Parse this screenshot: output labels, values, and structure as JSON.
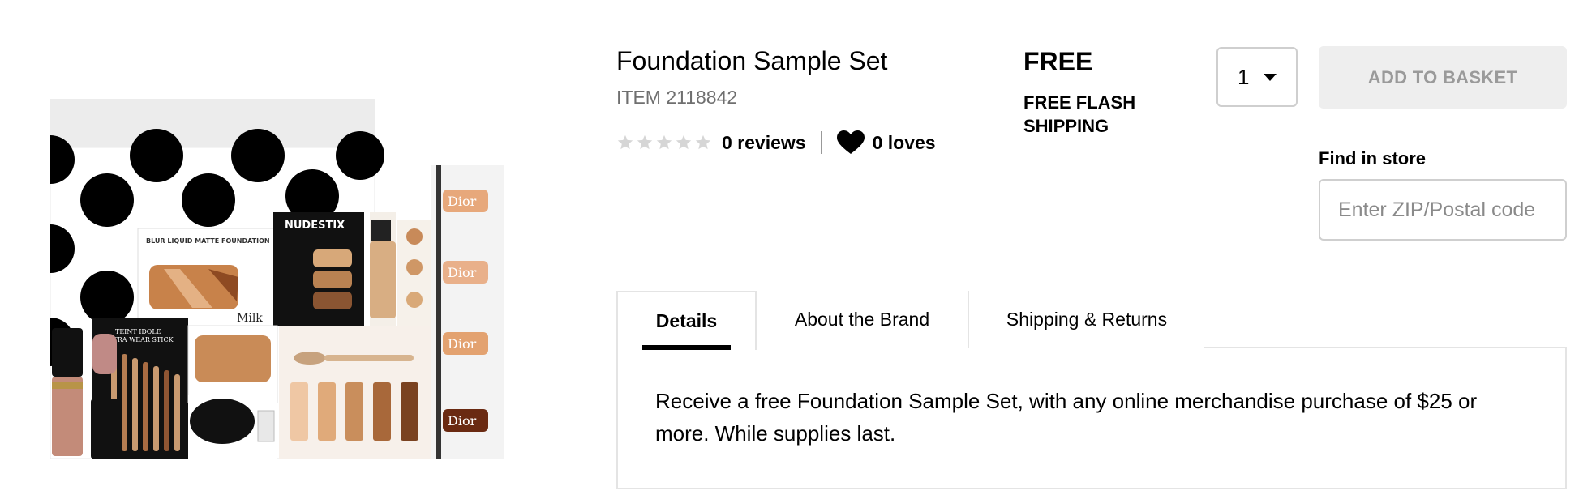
{
  "product": {
    "title": "Foundation Sample Set",
    "item_number": "ITEM 2118842",
    "rating_stars": 0,
    "reviews_label": "0 reviews",
    "loves_label": "0 loves",
    "image_texts": {
      "card1": "BLUR LIQUID MATTE FOUNDATION",
      "milk": "Milk",
      "nudestix": "NUDESTIX",
      "teint": "TEINT IDOLE",
      "teint2": "ULTRA WEAR STICK",
      "dior": "Dior"
    }
  },
  "price": {
    "amount": "FREE",
    "shipping_note": "FREE FLASH SHIPPING"
  },
  "purchase": {
    "quantity": "1",
    "add_to_basket_label": "ADD TO BASKET",
    "find_in_store_label": "Find in store",
    "zip_placeholder": "Enter ZIP/Postal code"
  },
  "tabs": [
    {
      "label": "Details",
      "active": true
    },
    {
      "label": "About the Brand",
      "active": false
    },
    {
      "label": "Shipping & Returns",
      "active": false
    }
  ],
  "details_text": "Receive a free Foundation Sample Set, with any online merchandise purchase of $25 or more. While supplies last.",
  "icons": {
    "star": "star-outline-icon",
    "heart": "heart-icon",
    "quantity_caret": "caret-down-icon"
  },
  "colors": {
    "basket_bg": "#eeeeee",
    "basket_text": "#9a9a9a",
    "item_text": "#6f6f6f",
    "border": "#cfcfcf"
  }
}
